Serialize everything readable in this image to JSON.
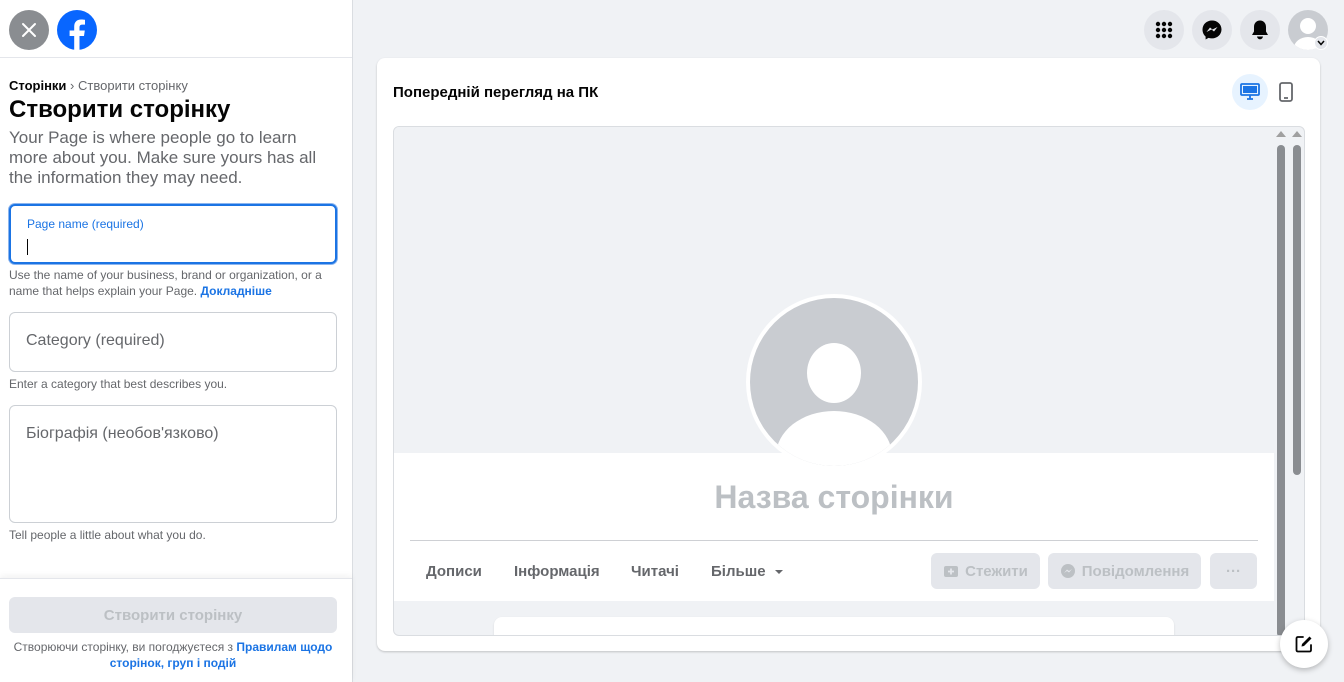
{
  "sidebar": {
    "breadcrumb_root": "Сторінки",
    "breadcrumb_sep": " › ",
    "breadcrumb_current": "Створити сторінку",
    "title": "Створити сторінку",
    "description": "Your Page is where people go to learn more about you. Make sure yours has all the information they may need.",
    "page_name_label": "Page name (required)",
    "page_name_value": "",
    "page_name_help": "Use the name of your business, brand or organization, or a name that helps explain your Page.",
    "learn_more": "Докладніше",
    "category_placeholder": "Category (required)",
    "category_help": "Enter a category that best describes you.",
    "bio_placeholder": "Біографія (необов'язково)",
    "bio_help": "Tell people a little about what you do.",
    "create_button": "Створити сторінку",
    "terms_prefix": "Створюючи сторінку, ви погоджуєтеся з ",
    "terms_link": "Правилам щодо сторінок, груп і подій"
  },
  "topnav": {
    "icons": [
      "menu-grid-icon",
      "messenger-icon",
      "notifications-icon",
      "account-icon"
    ]
  },
  "preview": {
    "title": "Попередній перегляд на ПК",
    "page_name": "Назва сторінки",
    "tabs": [
      "Дописи",
      "Інформація",
      "Читачі",
      "Більше"
    ],
    "follow_button": "Стежити",
    "message_button": "Повідомлення",
    "more_button": "···"
  },
  "colors": {
    "accent": "#1b74e4",
    "background": "#f0f2f5",
    "disabled_text": "#bcc0c4"
  }
}
